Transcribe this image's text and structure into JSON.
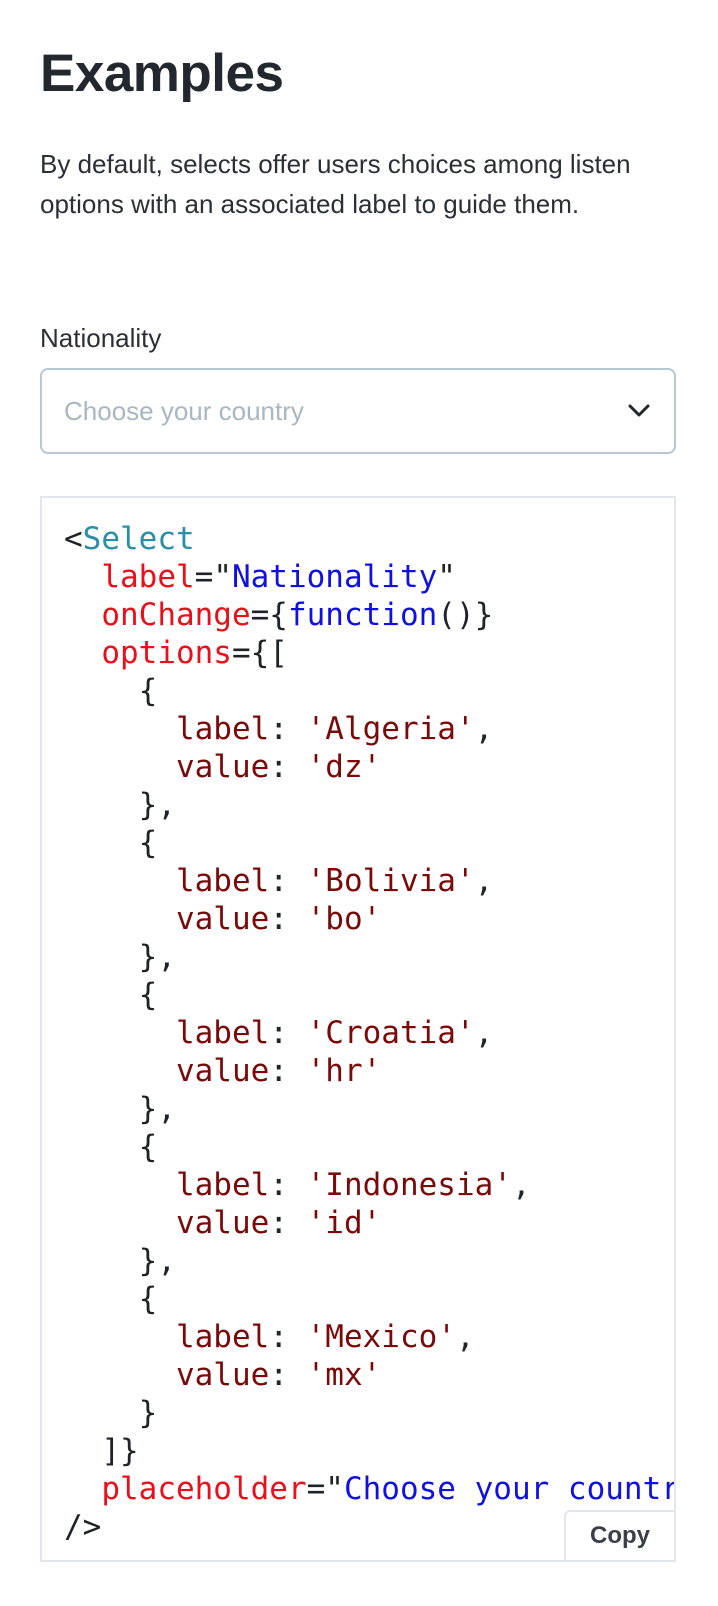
{
  "heading": "Examples",
  "intro": "By default, selects offer users choices among listen options with an associated label to guide them.",
  "select": {
    "label": "Nationality",
    "placeholder": "Choose your country",
    "options": [
      {
        "label": "Algeria",
        "value": "dz"
      },
      {
        "label": "Bolivia",
        "value": "bo"
      },
      {
        "label": "Croatia",
        "value": "hr"
      },
      {
        "label": "Indonesia",
        "value": "id"
      },
      {
        "label": "Mexico",
        "value": "mx"
      }
    ]
  },
  "code": {
    "component": "Select",
    "attr_label": "label",
    "attr_label_value": "Nationality",
    "attr_onchange": "onChange",
    "attr_onchange_value": "function()",
    "attr_options": "options",
    "key_label": "label",
    "key_value": "value",
    "attr_placeholder": "placeholder",
    "attr_placeholder_value": "Choose your country",
    "copy_label": "Copy"
  },
  "icons": {
    "dropdown": "chevron-down-icon"
  },
  "colors": {
    "tag": "#2a8fa6",
    "attribute": "#e8101a",
    "string": "#1010e0",
    "literal": "#7a0a0a",
    "placeholder": "#a9b6c4",
    "border": "#b9c6d4"
  }
}
